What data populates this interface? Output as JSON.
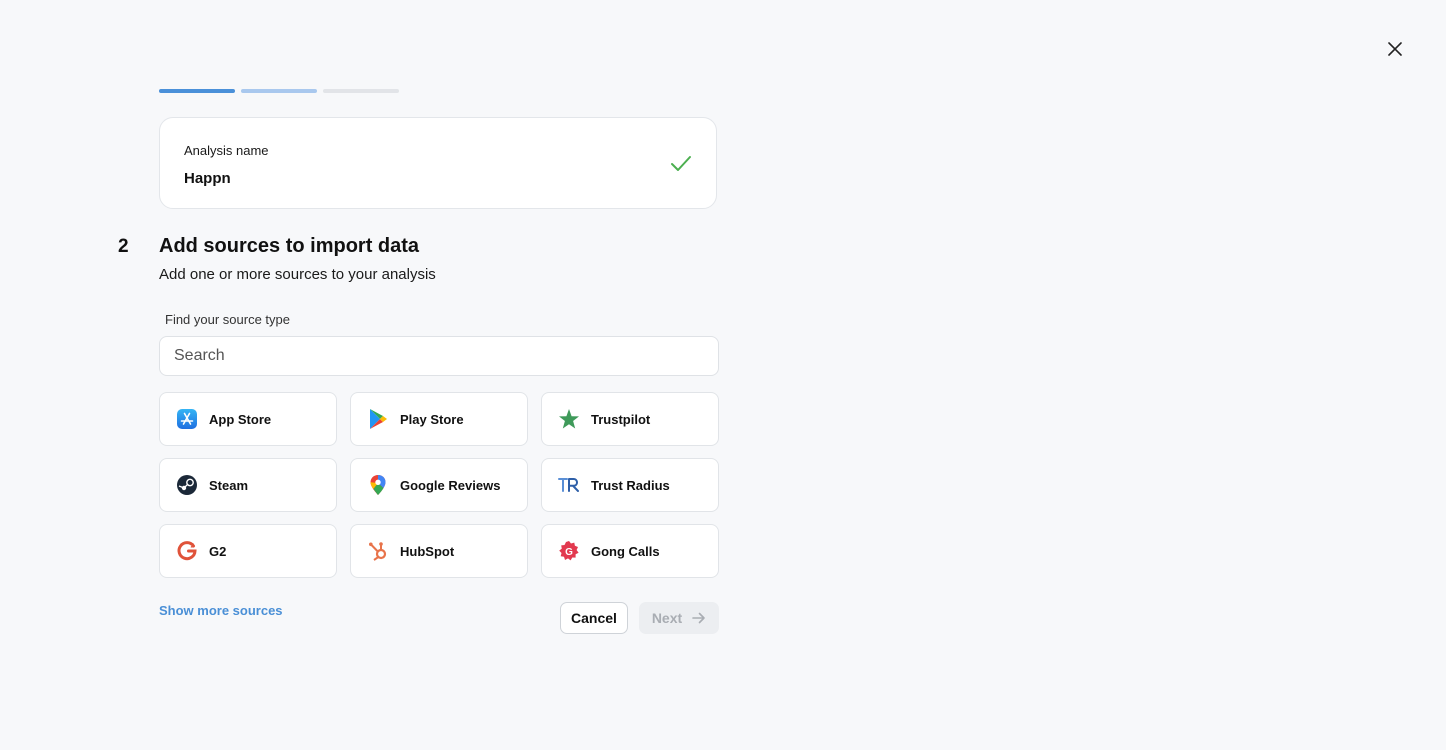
{
  "progress": {
    "colors": [
      "#4a90d9",
      "#a9c8ee",
      "#e2e4e8"
    ]
  },
  "name_card": {
    "label": "Analysis name",
    "value": "Happn",
    "check_icon": "check-icon",
    "check_color": "#4caf50"
  },
  "step": {
    "number": "2",
    "title": "Add sources to import data",
    "subtitle": "Add one or more sources to your analysis"
  },
  "search": {
    "label": "Find your source type",
    "placeholder": "Search",
    "value": ""
  },
  "sources": [
    {
      "label": "App Store",
      "icon": "app-store-icon"
    },
    {
      "label": "Play Store",
      "icon": "play-store-icon"
    },
    {
      "label": "Trustpilot",
      "icon": "trustpilot-star-icon"
    },
    {
      "label": "Steam",
      "icon": "steam-icon"
    },
    {
      "label": "Google Reviews",
      "icon": "google-maps-pin-icon"
    },
    {
      "label": "Trust Radius",
      "icon": "trust-radius-icon"
    },
    {
      "label": "G2",
      "icon": "g2-icon"
    },
    {
      "label": "HubSpot",
      "icon": "hubspot-icon"
    },
    {
      "label": "Gong Calls",
      "icon": "gong-icon"
    }
  ],
  "footer": {
    "show_more": "Show more sources",
    "cancel": "Cancel",
    "next": "Next"
  },
  "colors": {
    "accent": "#4a8fd6",
    "background": "#f7f8fa"
  }
}
